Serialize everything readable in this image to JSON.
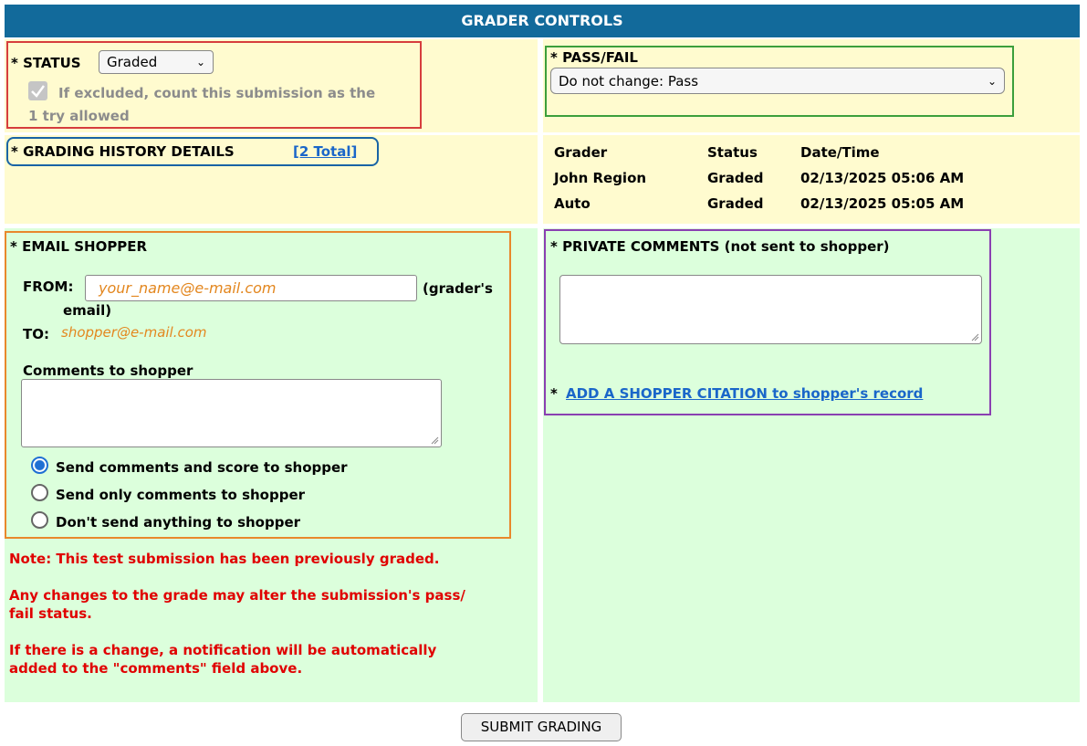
{
  "header": {
    "title": "GRADER CONTROLS"
  },
  "status": {
    "label": "* STATUS",
    "selected": "Graded",
    "checkbox_label_line1": "If excluded, count this submission as the",
    "checkbox_label_line2": "1 try allowed",
    "checkbox_checked": true
  },
  "pass_fail": {
    "label": "* PASS/FAIL",
    "selected": "Do not change: Pass"
  },
  "history": {
    "label": "* GRADING HISTORY DETAILS",
    "link": "[2 Total]",
    "columns": [
      "Grader",
      "Status",
      "Date/Time"
    ],
    "rows": [
      [
        "John Region",
        "Graded",
        "02/13/2025 05:06 AM"
      ],
      [
        "Auto",
        "Graded",
        "02/13/2025 05:05 AM"
      ]
    ]
  },
  "email": {
    "label": "* EMAIL SHOPPER",
    "from_label": "FROM:",
    "from_value": "your_name@e-mail.com",
    "from_note_line1": "(grader's",
    "from_note_line2": "email)",
    "to_label": "TO:",
    "to_value": "shopper@e-mail.com",
    "comments_label": "Comments to shopper",
    "comments_value": "",
    "options": [
      "Send comments and score to shopper",
      "Send only comments to shopper",
      "Don't send anything to shopper"
    ],
    "selected_option": "Send comments and score to shopper"
  },
  "private": {
    "label": "* PRIVATE COMMENTS (not sent to shopper)",
    "value": "",
    "citation_prefix": "*",
    "citation_link": "ADD A SHOPPER CITATION to shopper's record"
  },
  "notes": {
    "line1": "Note: This test submission has been previously graded.",
    "line2a": "Any changes to the grade may alter the submission's pass/",
    "line2b": "fail status.",
    "line3a": "If there is a change, a notification will be automatically",
    "line3b": "added to the \"comments\" field above."
  },
  "submit": {
    "label": "SUBMIT GRADING"
  },
  "colors": {
    "header_bg": "#126a9b",
    "yellow_panel": "#fffbcf",
    "green_panel": "#dcffdc",
    "note_red": "#e00000"
  }
}
